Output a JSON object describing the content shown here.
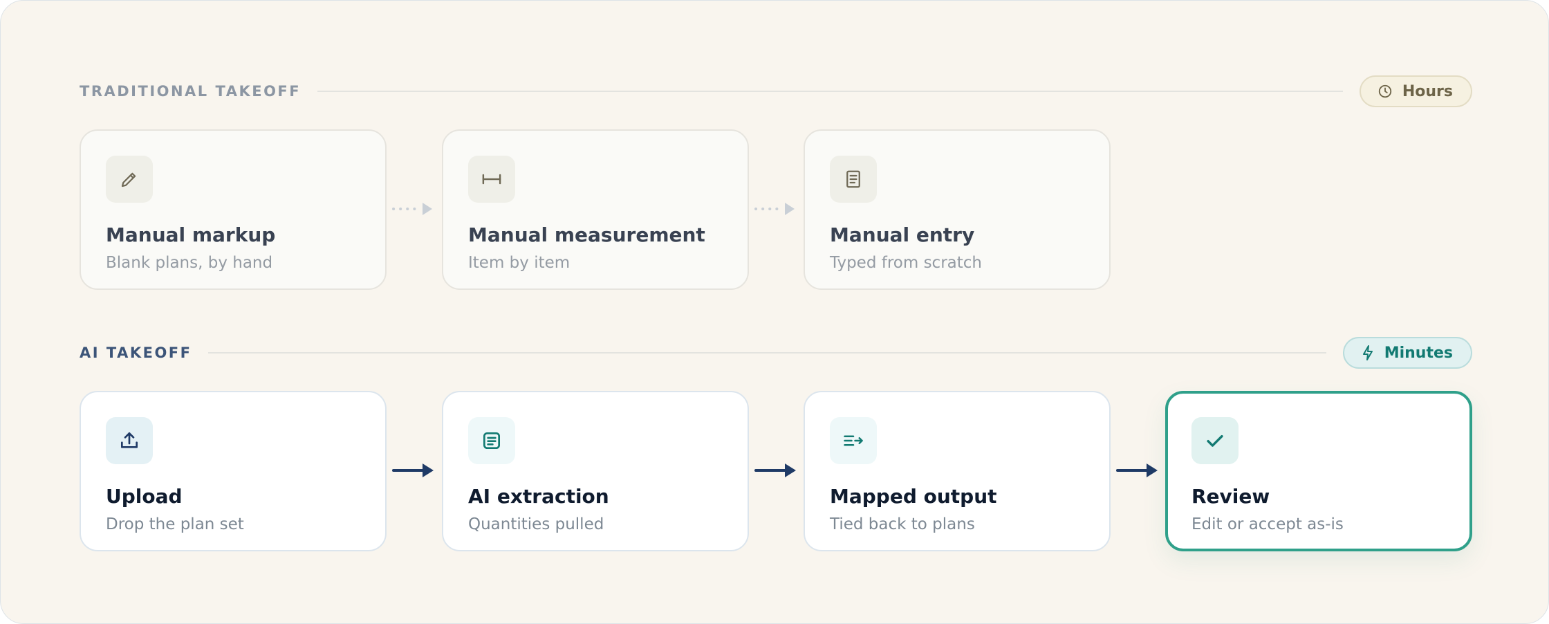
{
  "traditional": {
    "title": "TRADITIONAL TAKEOFF",
    "badge": {
      "icon": "clock-icon",
      "label": "Hours"
    },
    "steps": [
      {
        "icon": "pencil-icon",
        "title": "Manual markup",
        "subtitle": "Blank plans, by hand"
      },
      {
        "icon": "ruler-icon",
        "title": "Manual measurement",
        "subtitle": "Item by item"
      },
      {
        "icon": "document-icon",
        "title": "Manual entry",
        "subtitle": "Typed from scratch"
      }
    ]
  },
  "ai": {
    "title": "AI TAKEOFF",
    "badge": {
      "icon": "lightning-icon",
      "label": "Minutes"
    },
    "steps": [
      {
        "icon": "upload-icon",
        "title": "Upload",
        "subtitle": "Drop the plan set"
      },
      {
        "icon": "document-lines-icon",
        "title": "AI extraction",
        "subtitle": "Quantities pulled"
      },
      {
        "icon": "list-arrow-icon",
        "title": "Mapped output",
        "subtitle": "Tied back to plans"
      },
      {
        "icon": "check-icon",
        "title": "Review",
        "subtitle": "Edit or accept as-is"
      }
    ]
  },
  "colors": {
    "background": "#f9f5ee",
    "accent_teal": "#2fa08a",
    "arrow_navy": "#1f3a66",
    "dotted_arrow": "#c9cfd6"
  }
}
